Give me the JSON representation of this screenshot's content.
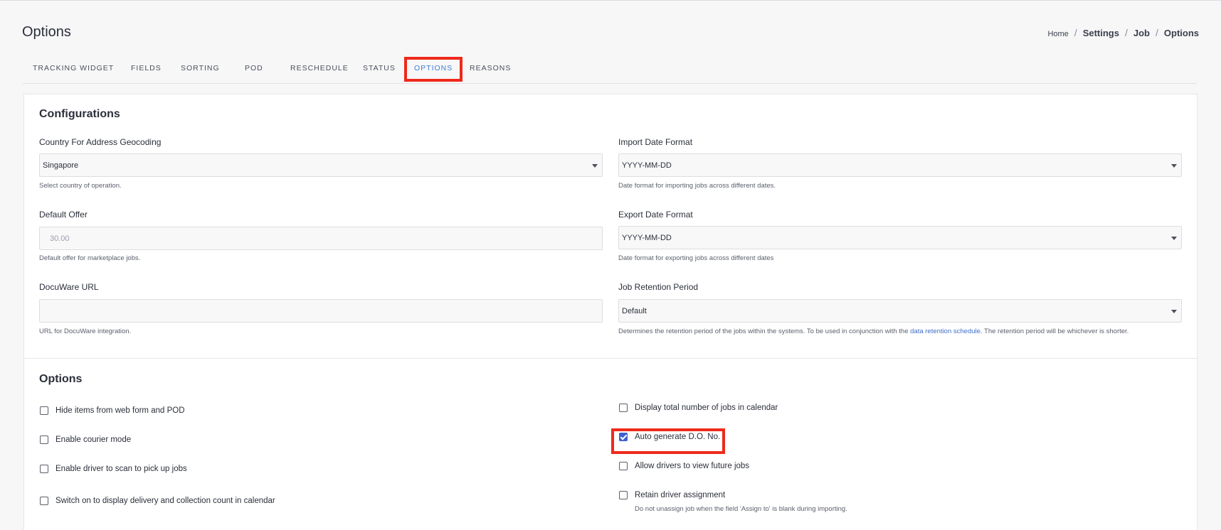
{
  "page": {
    "title": "Options"
  },
  "breadcrumb": {
    "home": "Home",
    "items": [
      "Settings",
      "Job",
      "Options"
    ]
  },
  "tabs": [
    {
      "label": "TRACKING WIDGET"
    },
    {
      "label": "FIELDS"
    },
    {
      "label": "SORTING"
    },
    {
      "label": "POD"
    },
    {
      "label": "RESCHEDULE"
    },
    {
      "label": "STATUS"
    },
    {
      "label": "OPTIONS",
      "active": true
    },
    {
      "label": "REASONS"
    }
  ],
  "configurations": {
    "title": "Configurations",
    "country": {
      "label": "Country For Address Geocoding",
      "value": "Singapore",
      "help": "Select country of operation."
    },
    "import_date": {
      "label": "Import Date Format",
      "value": "YYYY-MM-DD",
      "help": "Date format for importing jobs across different dates."
    },
    "default_offer": {
      "label": "Default Offer",
      "placeholder": "30.00",
      "help": "Default offer for marketplace jobs."
    },
    "export_date": {
      "label": "Export Date Format",
      "value": "YYYY-MM-DD",
      "help": "Date format for exporting jobs across different dates"
    },
    "docuware": {
      "label": "DocuWare URL",
      "value": "",
      "help": "URL for DocuWare integration."
    },
    "retention": {
      "label": "Job Retention Period",
      "value": "Default",
      "help_pre": "Determines the retention period of the jobs within the systems. To be used in conjunction with the ",
      "help_link": "data retention schedule",
      "help_post": ". The retention period will be whichever is shorter."
    }
  },
  "options": {
    "title": "Options",
    "left": [
      {
        "label": "Hide items from web form and POD",
        "checked": false
      },
      {
        "label": "Enable courier mode",
        "checked": false
      },
      {
        "label": "Enable driver to scan to pick up jobs",
        "checked": false
      },
      {
        "label": "Switch on to display delivery and collection count in calendar",
        "checked": false
      }
    ],
    "right": [
      {
        "label": "Display total number of jobs in calendar",
        "checked": false
      },
      {
        "label": "Auto generate D.O. No.",
        "checked": true
      },
      {
        "label": "Allow drivers to view future jobs",
        "checked": false
      },
      {
        "label": "Retain driver assignment",
        "checked": false,
        "sub": "Do not unassign job when the field 'Assign to' is blank during importing."
      }
    ]
  },
  "colors": {
    "accent": "#3f7fd9",
    "highlight": "#ee2a1b",
    "checkbox": "#3d5fd1"
  }
}
